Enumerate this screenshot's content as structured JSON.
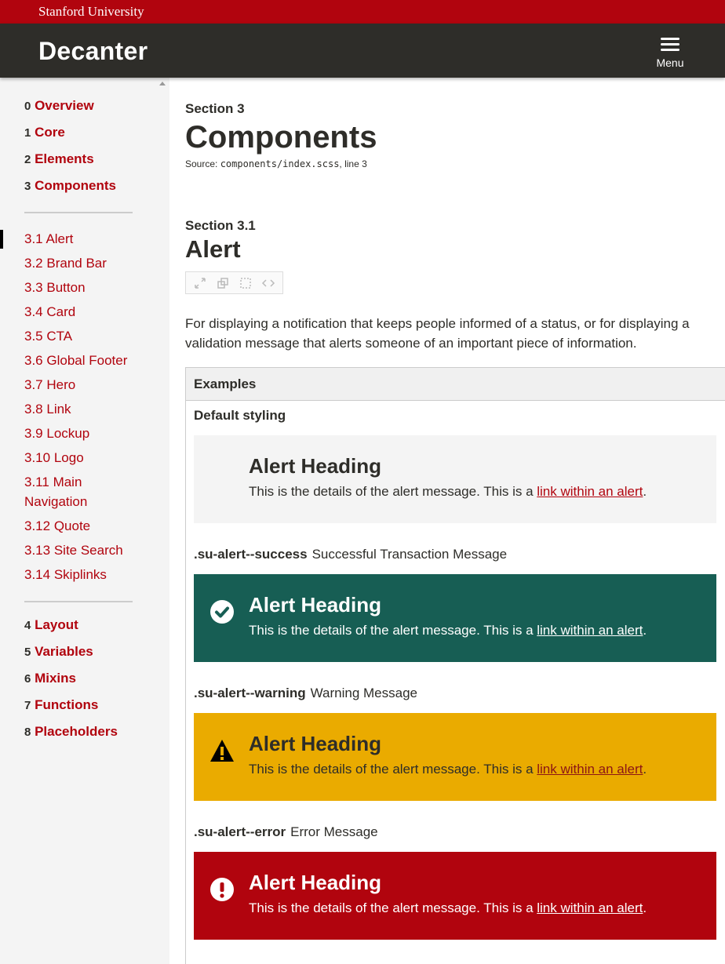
{
  "brand_bar": {
    "text": "Stanford University"
  },
  "header": {
    "site_title": "Decanter",
    "menu_label": "Menu"
  },
  "sidebar": {
    "top_items": [
      {
        "num": "0",
        "label": "Overview"
      },
      {
        "num": "1",
        "label": "Core"
      },
      {
        "num": "2",
        "label": "Elements"
      },
      {
        "num": "3",
        "label": "Components"
      }
    ],
    "sub_items": [
      {
        "num": "3.1",
        "label": "Alert"
      },
      {
        "num": "3.2",
        "label": "Brand Bar"
      },
      {
        "num": "3.3",
        "label": "Button"
      },
      {
        "num": "3.4",
        "label": "Card"
      },
      {
        "num": "3.5",
        "label": "CTA"
      },
      {
        "num": "3.6",
        "label": "Global Footer"
      },
      {
        "num": "3.7",
        "label": "Hero"
      },
      {
        "num": "3.8",
        "label": "Link"
      },
      {
        "num": "3.9",
        "label": "Lockup"
      },
      {
        "num": "3.10",
        "label": "Logo"
      },
      {
        "num": "3.11",
        "label": "Main Navigation"
      },
      {
        "num": "3.12",
        "label": "Quote"
      },
      {
        "num": "3.13",
        "label": "Site Search"
      },
      {
        "num": "3.14",
        "label": "Skiplinks"
      }
    ],
    "bottom_items": [
      {
        "num": "4",
        "label": "Layout"
      },
      {
        "num": "5",
        "label": "Variables"
      },
      {
        "num": "6",
        "label": "Mixins"
      },
      {
        "num": "7",
        "label": "Functions"
      },
      {
        "num": "8",
        "label": "Placeholders"
      }
    ]
  },
  "main": {
    "section_label": "Section 3",
    "title": "Components",
    "source_prefix": "Source: ",
    "source_file": "components/index.scss",
    "source_suffix": ", line 3",
    "subsection_label": "Section 3.1",
    "subsection_title": "Alert",
    "description": "For displaying a notification that keeps people informed of a status, or for displaying a validation message that alerts someone of an important piece of information.",
    "examples_header": "Examples",
    "default_label": "Default styling",
    "alert_heading": "Alert Heading",
    "alert_body_prefix": "This is the details of the alert message. This is a ",
    "alert_link": "link within an alert",
    "alert_body_suffix": ".",
    "modifiers": [
      {
        "class": ".su-alert--success",
        "desc": "Successful Transaction Message"
      },
      {
        "class": ".su-alert--warning",
        "desc": "Warning Message"
      },
      {
        "class": ".su-alert--error",
        "desc": "Error Message"
      }
    ]
  },
  "colors": {
    "cardinal": "#b1040e",
    "header_dark": "#2e2d29",
    "success": "#175e54",
    "warning": "#eaab00",
    "error": "#b1040e",
    "sidebar_bg": "#f4f4f4"
  },
  "icons": [
    "menu-icon",
    "fullscreen-icon",
    "new-window-icon",
    "outline-icon",
    "code-icon",
    "check-circle-icon",
    "warning-triangle-icon",
    "exclamation-circle-icon"
  ]
}
